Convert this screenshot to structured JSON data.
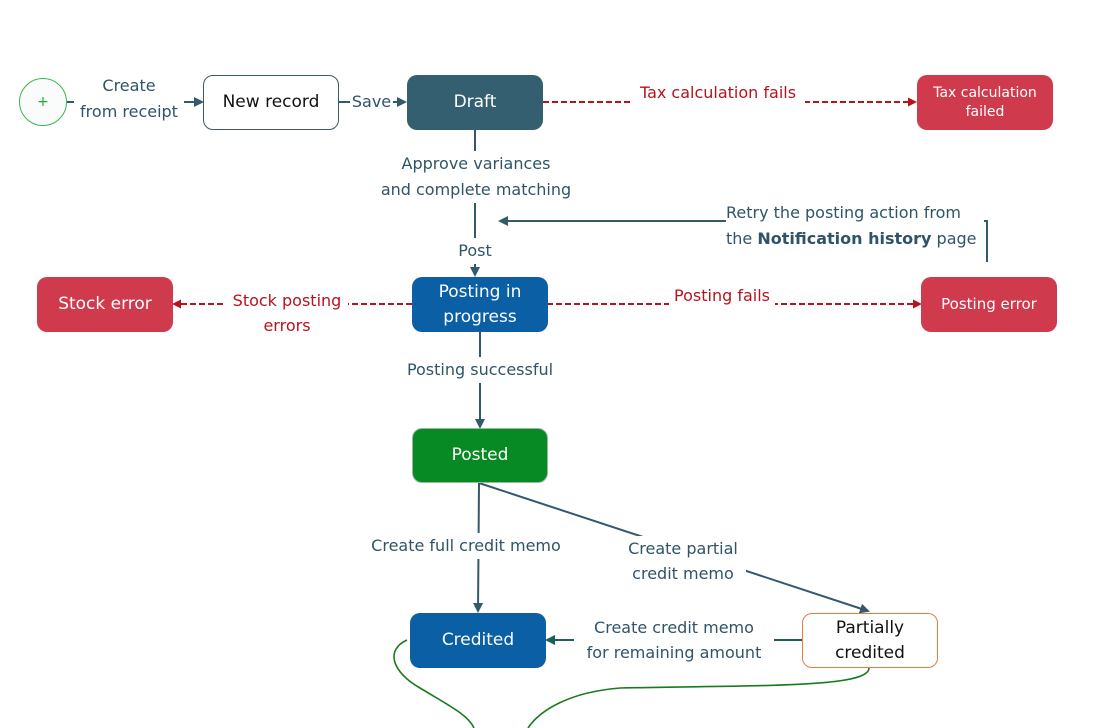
{
  "colors": {
    "flow": "#34596b",
    "error_flow": "#b8131d",
    "error_node": "#cf3a4c",
    "draft_node": "#345f70",
    "progress_node": "#0a5fa5",
    "posted_node": "#078a23",
    "start_circle": "#3cb54a",
    "partial_border": "#e87a3f",
    "curve": "#1a7a1f"
  },
  "start": {
    "icon": "plus-icon",
    "glyph": "+"
  },
  "nodes": {
    "new_record": "New record",
    "draft": "Draft",
    "tax_failed": [
      "Tax calculation",
      "failed"
    ],
    "stock_error": "Stock error",
    "posting_in_progress": [
      "Posting in",
      "progress"
    ],
    "posting_error": "Posting error",
    "posted": "Posted",
    "credited": "Credited",
    "partially_credited": [
      "Partially",
      "credited"
    ]
  },
  "transitions": {
    "create_from_receipt": [
      "Create",
      "from receipt"
    ],
    "save": "Save",
    "tax_fails": "Tax calculation fails",
    "approve": [
      "Approve variances",
      "and complete matching"
    ],
    "post": "Post",
    "retry": {
      "line1": "Retry the posting action from",
      "line2_prefix": "the ",
      "line2_bold": "Notification history",
      "line2_suffix": " page"
    },
    "stock_posting_errors": [
      "Stock posting",
      "errors"
    ],
    "posting_fails": "Posting fails",
    "posting_successful": "Posting successful",
    "full_credit_memo": "Create full credit memo",
    "partial_credit_memo": [
      "Create partial",
      "credit memo"
    ],
    "remaining_amount": [
      "Create credit memo",
      "for remaining amount"
    ]
  }
}
